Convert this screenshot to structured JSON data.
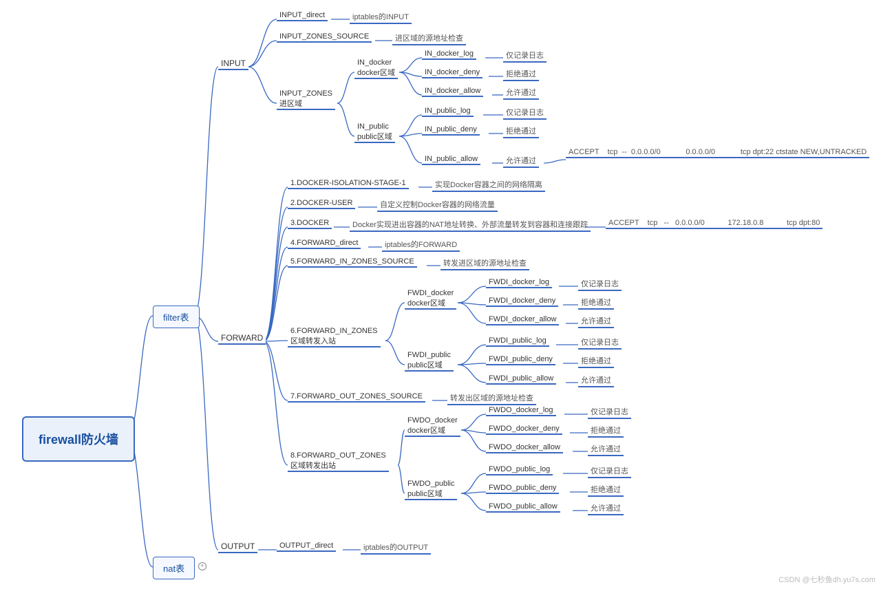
{
  "root": "firewall防火墙",
  "filter": "filter表",
  "nat": "nat表",
  "input": "INPUT",
  "forward": "FORWARD",
  "output": "OUTPUT",
  "in_direct": "INPUT_direct",
  "in_direct_d": "iptables的INPUT",
  "in_zsrc": "INPUT_ZONES_SOURCE",
  "in_zsrc_d": "进区域的源地址检查",
  "in_zones": "INPUT_ZONES",
  "in_zones2": "进区域",
  "indk": "IN_docker",
  "indk2": "docker区域",
  "indk_log": "IN_docker_log",
  "indk_log_d": "仅记录日志",
  "indk_deny": "IN_docker_deny",
  "indk_deny_d": "拒绝通过",
  "indk_allow": "IN_docker_allow",
  "indk_allow_d": "允许通过",
  "inpb": "IN_public",
  "inpb2": "public区域",
  "inpb_log": "IN_public_log",
  "inpb_log_d": "仅记录日志",
  "inpb_deny": "IN_public_deny",
  "inpb_deny_d": "拒绝通过",
  "inpb_allow": "IN_public_allow",
  "inpb_allow_d": "允许通过",
  "rule1": "ACCEPT    tcp  --  0.0.0.0/0            0.0.0.0/0            tcp dpt:22 ctstate NEW,UNTRACKED",
  "f1": "1.DOCKER-ISOLATION-STAGE-1",
  "f1d": "实现Docker容器之间的网络隔离",
  "f2": "2.DOCKER-USER",
  "f2d": "自定义控制Docker容器的网络流量",
  "f3": "3.DOCKER",
  "f3d": "Docker实现进出容器的NAT地址转换、外部流量转发到容器和连接跟踪",
  "rule2": "ACCEPT    tcp   --   0.0.0.0/0           172.18.0.8           tcp dpt:80",
  "f4": "4.FORWARD_direct",
  "f4d": "iptables的FORWARD",
  "f5": "5.FORWARD_IN_ZONES_SOURCE",
  "f5d": "转发进区域的源地址检查",
  "f6": "6.FORWARD_IN_ZONES",
  "f62": "区域转发入站",
  "fidk": "FWDI_docker",
  "fidk2": "docker区域",
  "fidk_log": "FWDI_docker_log",
  "fidk_log_d": "仅记录日志",
  "fidk_deny": "FWDI_docker_deny",
  "fidk_deny_d": "拒绝通过",
  "fidk_allow": "FWDI_docker_allow",
  "fidk_allow_d": "允许通过",
  "fipb": "FWDI_public",
  "fipb2": "public区域",
  "fipb_log": "FWDI_public_log",
  "fipb_log_d": "仅记录日志",
  "fipb_deny": "FWDI_public_deny",
  "fipb_deny_d": "拒绝通过",
  "fipb_allow": "FWDI_public_allow",
  "fipb_allow_d": "允许通过",
  "f7": "7.FORWARD_OUT_ZONES_SOURCE",
  "f7d": "转发出区域的源地址检查",
  "f8": "8.FORWARD_OUT_ZONES",
  "f82": "区域转发出站",
  "fodk": "FWDO_docker",
  "fodk2": "docker区域",
  "fodk_log": "FWDO_docker_log",
  "fodk_log_d": "仅记录日志",
  "fodk_deny": "FWDO_docker_deny",
  "fodk_deny_d": "拒绝通过",
  "fodk_allow": "FWDO_docker_allow",
  "fodk_allow_d": "允许通过",
  "fopb": "FWDO_public",
  "fopb2": "public区域",
  "fopb_log": "FWDO_public_log",
  "fopb_log_d": "仅记录日志",
  "fopb_deny": "FWDO_public_deny",
  "fopb_deny_d": "拒绝通过",
  "fopb_allow": "FWDO_public_allow",
  "fopb_allow_d": "允许通过",
  "out_direct": "OUTPUT_direct",
  "out_direct_d": "iptables的OUTPUT",
  "watermark": "CSDN @七秒鱼dh.yu7s.com"
}
